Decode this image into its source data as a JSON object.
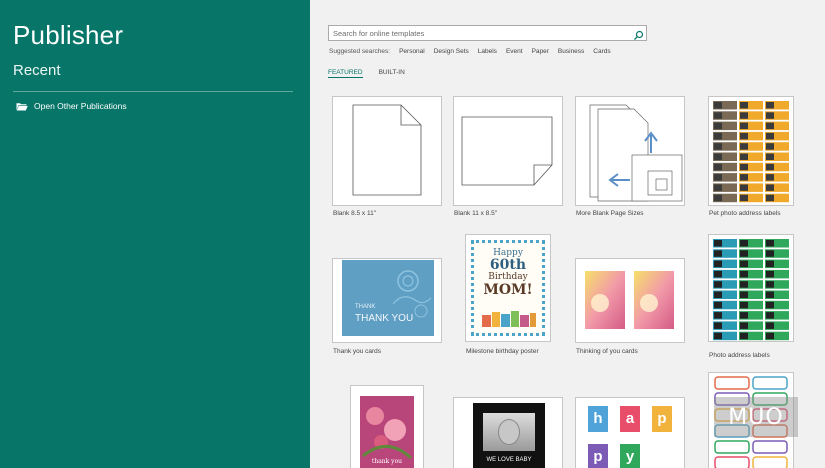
{
  "app": {
    "title": "Publisher",
    "recent_heading": "Recent",
    "open_other_label": "Open Other Publications"
  },
  "search": {
    "placeholder": "Search for online templates",
    "value": ""
  },
  "suggested": {
    "label": "Suggested searches:",
    "items": [
      "Personal",
      "Design Sets",
      "Labels",
      "Event",
      "Paper",
      "Business",
      "Cards"
    ]
  },
  "tabs": [
    {
      "label": "FEATURED",
      "active": true
    },
    {
      "label": "BUILT-IN",
      "active": false
    }
  ],
  "templates": [
    {
      "label": "Blank 8.5 x 11\""
    },
    {
      "label": "Blank 11 x 8.5\""
    },
    {
      "label": "More Blank Page Sizes"
    },
    {
      "label": "Pet photo address labels"
    },
    {
      "label": "Thank you cards",
      "thumb_text": "THANK YOU"
    },
    {
      "label": "Milestone birthday poster",
      "thumb_lines": [
        "Happy",
        "60th",
        "Birthday",
        "MOM!"
      ]
    },
    {
      "label": "Thinking of you cards"
    },
    {
      "label": "Photo address labels"
    },
    {
      "label": "",
      "thumb_text": "thank you"
    },
    {
      "label": "",
      "thumb_text": "WE LOVE BABY"
    },
    {
      "label": "",
      "thumb_letters": [
        "h",
        "a",
        "p",
        "p",
        "y"
      ]
    },
    {
      "label": ""
    }
  ],
  "watermark": "MUO",
  "colors": {
    "accent": "#077568",
    "background": "#f1f1f1",
    "label_orange": "#f0a92a",
    "label_brown": "#7a6a55",
    "label_green": "#2fa85b",
    "label_teal": "#2a9bb5"
  }
}
